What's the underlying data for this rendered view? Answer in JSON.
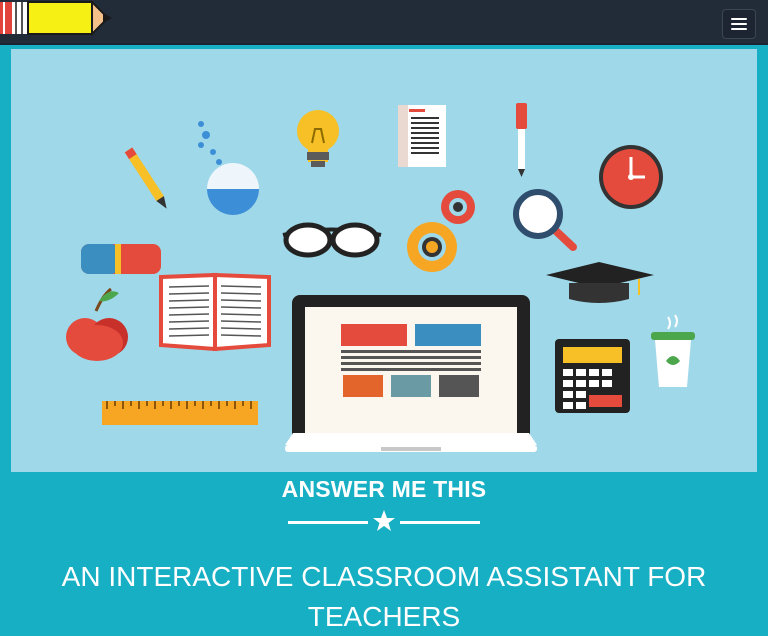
{
  "nav": {
    "logo_icon": "pencil-logo-icon",
    "menu_icon": "hamburger-menu-icon"
  },
  "hero": {
    "illustration": "classroom-supplies-illustration",
    "icons": [
      "pencil-icon",
      "flask-icon",
      "lightbulb-icon",
      "document-icon",
      "marker-icon",
      "clock-icon",
      "eraser-icon",
      "glasses-icon",
      "gears-icon",
      "magnifier-icon",
      "graduation-cap-icon",
      "apple-icon",
      "open-book-icon",
      "laptop-icon",
      "calculator-icon",
      "coffee-cup-icon",
      "ruler-icon"
    ]
  },
  "brand": {
    "title": "ANSWER ME THIS",
    "divider_icon": "star-icon"
  },
  "tagline": "AN INTERACTIVE CLASSROOM ASSISTANT FOR TEACHERS",
  "colors": {
    "navbar": "#222c39",
    "background": "#17afc3",
    "hero_bg": "#9fd8e9",
    "text": "#ffffff"
  }
}
